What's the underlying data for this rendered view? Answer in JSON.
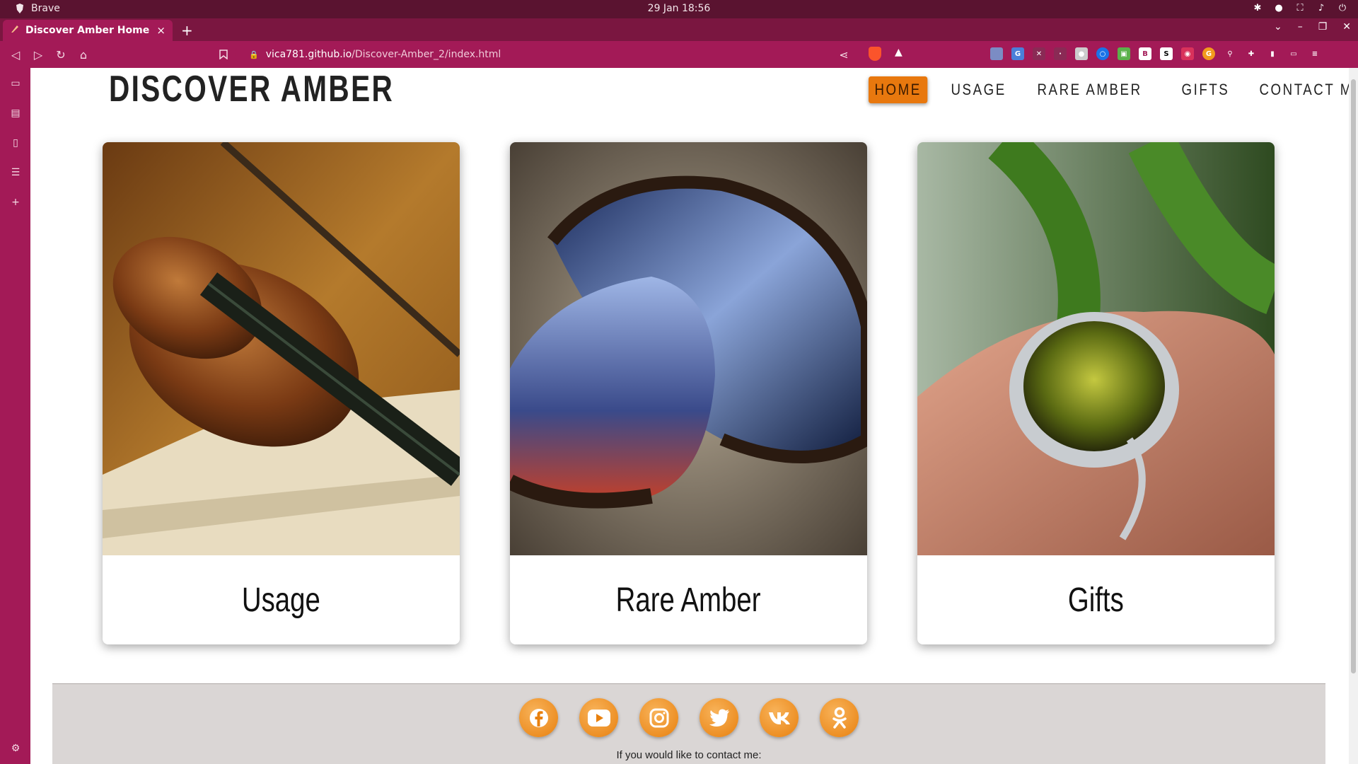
{
  "os": {
    "app_name": "Brave",
    "clock": "29 Jan  18:56"
  },
  "browser": {
    "tab_title": "Discover Amber Home",
    "tab_close": "×",
    "new_tab": "+",
    "url_host": "vica781.github.io",
    "url_path": "/Discover-Amber_2/index.html",
    "accent_color": "#a31a57"
  },
  "site": {
    "title": "DISCOVER AMBER",
    "nav": [
      {
        "label": "HOME",
        "active": true
      },
      {
        "label": "USAGE",
        "active": false
      },
      {
        "label": "RARE AMBER",
        "active": false
      },
      {
        "label": "GIFTS",
        "active": false
      },
      {
        "label": "CONTACT ME",
        "active": false
      }
    ],
    "nav_active_color": "#e8780e",
    "cards": [
      {
        "label": "Usage",
        "image": "violin-on-sheet-music"
      },
      {
        "label": "Rare Amber",
        "image": "blue-amber-stones"
      },
      {
        "label": "Gifts",
        "image": "amber-ring-on-hand"
      }
    ],
    "footer": {
      "social": [
        "facebook-icon",
        "youtube-icon",
        "instagram-icon",
        "twitter-icon",
        "vk-icon",
        "odnoklassniki-icon"
      ],
      "contact_text": "If you would like to contact me:",
      "social_color": "#e8800e"
    }
  }
}
